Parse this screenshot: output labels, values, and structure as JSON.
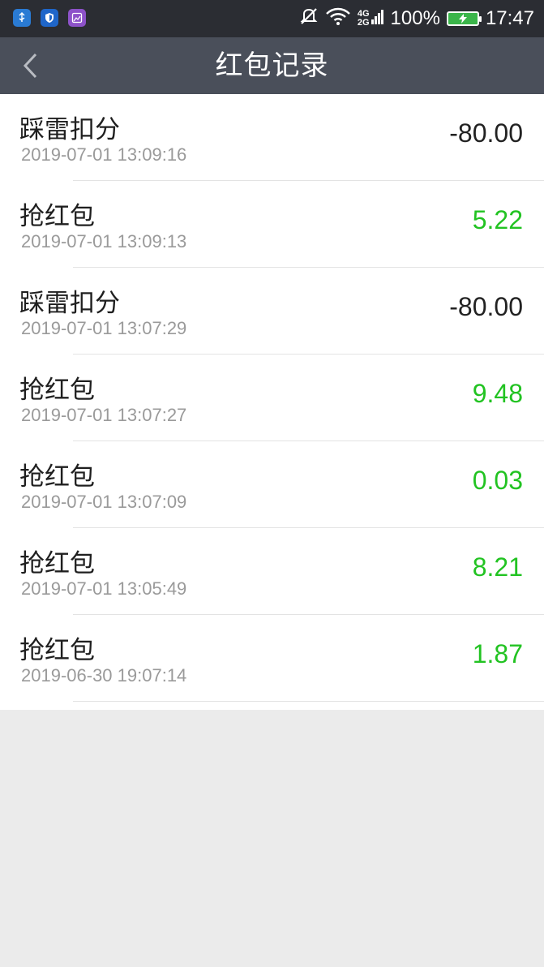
{
  "status_bar": {
    "battery": "100%",
    "time": "17:47",
    "net_top": "4G",
    "net_bottom": "2G",
    "icons": [
      "usb-icon",
      "shield-icon",
      "gallery-icon",
      "mute-icon",
      "wifi-icon",
      "signal-icon",
      "battery-icon"
    ]
  },
  "nav": {
    "title": "红包记录",
    "back_icon": "chevron-left-icon"
  },
  "colors": {
    "positive": "#22c322",
    "negative": "#222222",
    "nav_bg": "#4a4f5a",
    "status_bg": "#2b2d33"
  },
  "records": [
    {
      "title": "踩雷扣分",
      "time": "2019-07-01 13:09:16",
      "amount": "-80.00",
      "type": "negative"
    },
    {
      "title": "抢红包",
      "time": "2019-07-01 13:09:13",
      "amount": "5.22",
      "type": "positive"
    },
    {
      "title": "踩雷扣分",
      "time": "2019-07-01 13:07:29",
      "amount": "-80.00",
      "type": "negative"
    },
    {
      "title": "抢红包",
      "time": "2019-07-01 13:07:27",
      "amount": "9.48",
      "type": "positive"
    },
    {
      "title": "抢红包",
      "time": "2019-07-01 13:07:09",
      "amount": "0.03",
      "type": "positive"
    },
    {
      "title": "抢红包",
      "time": "2019-07-01 13:05:49",
      "amount": "8.21",
      "type": "positive"
    },
    {
      "title": "抢红包",
      "time": "2019-06-30 19:07:14",
      "amount": "1.87",
      "type": "positive"
    }
  ]
}
